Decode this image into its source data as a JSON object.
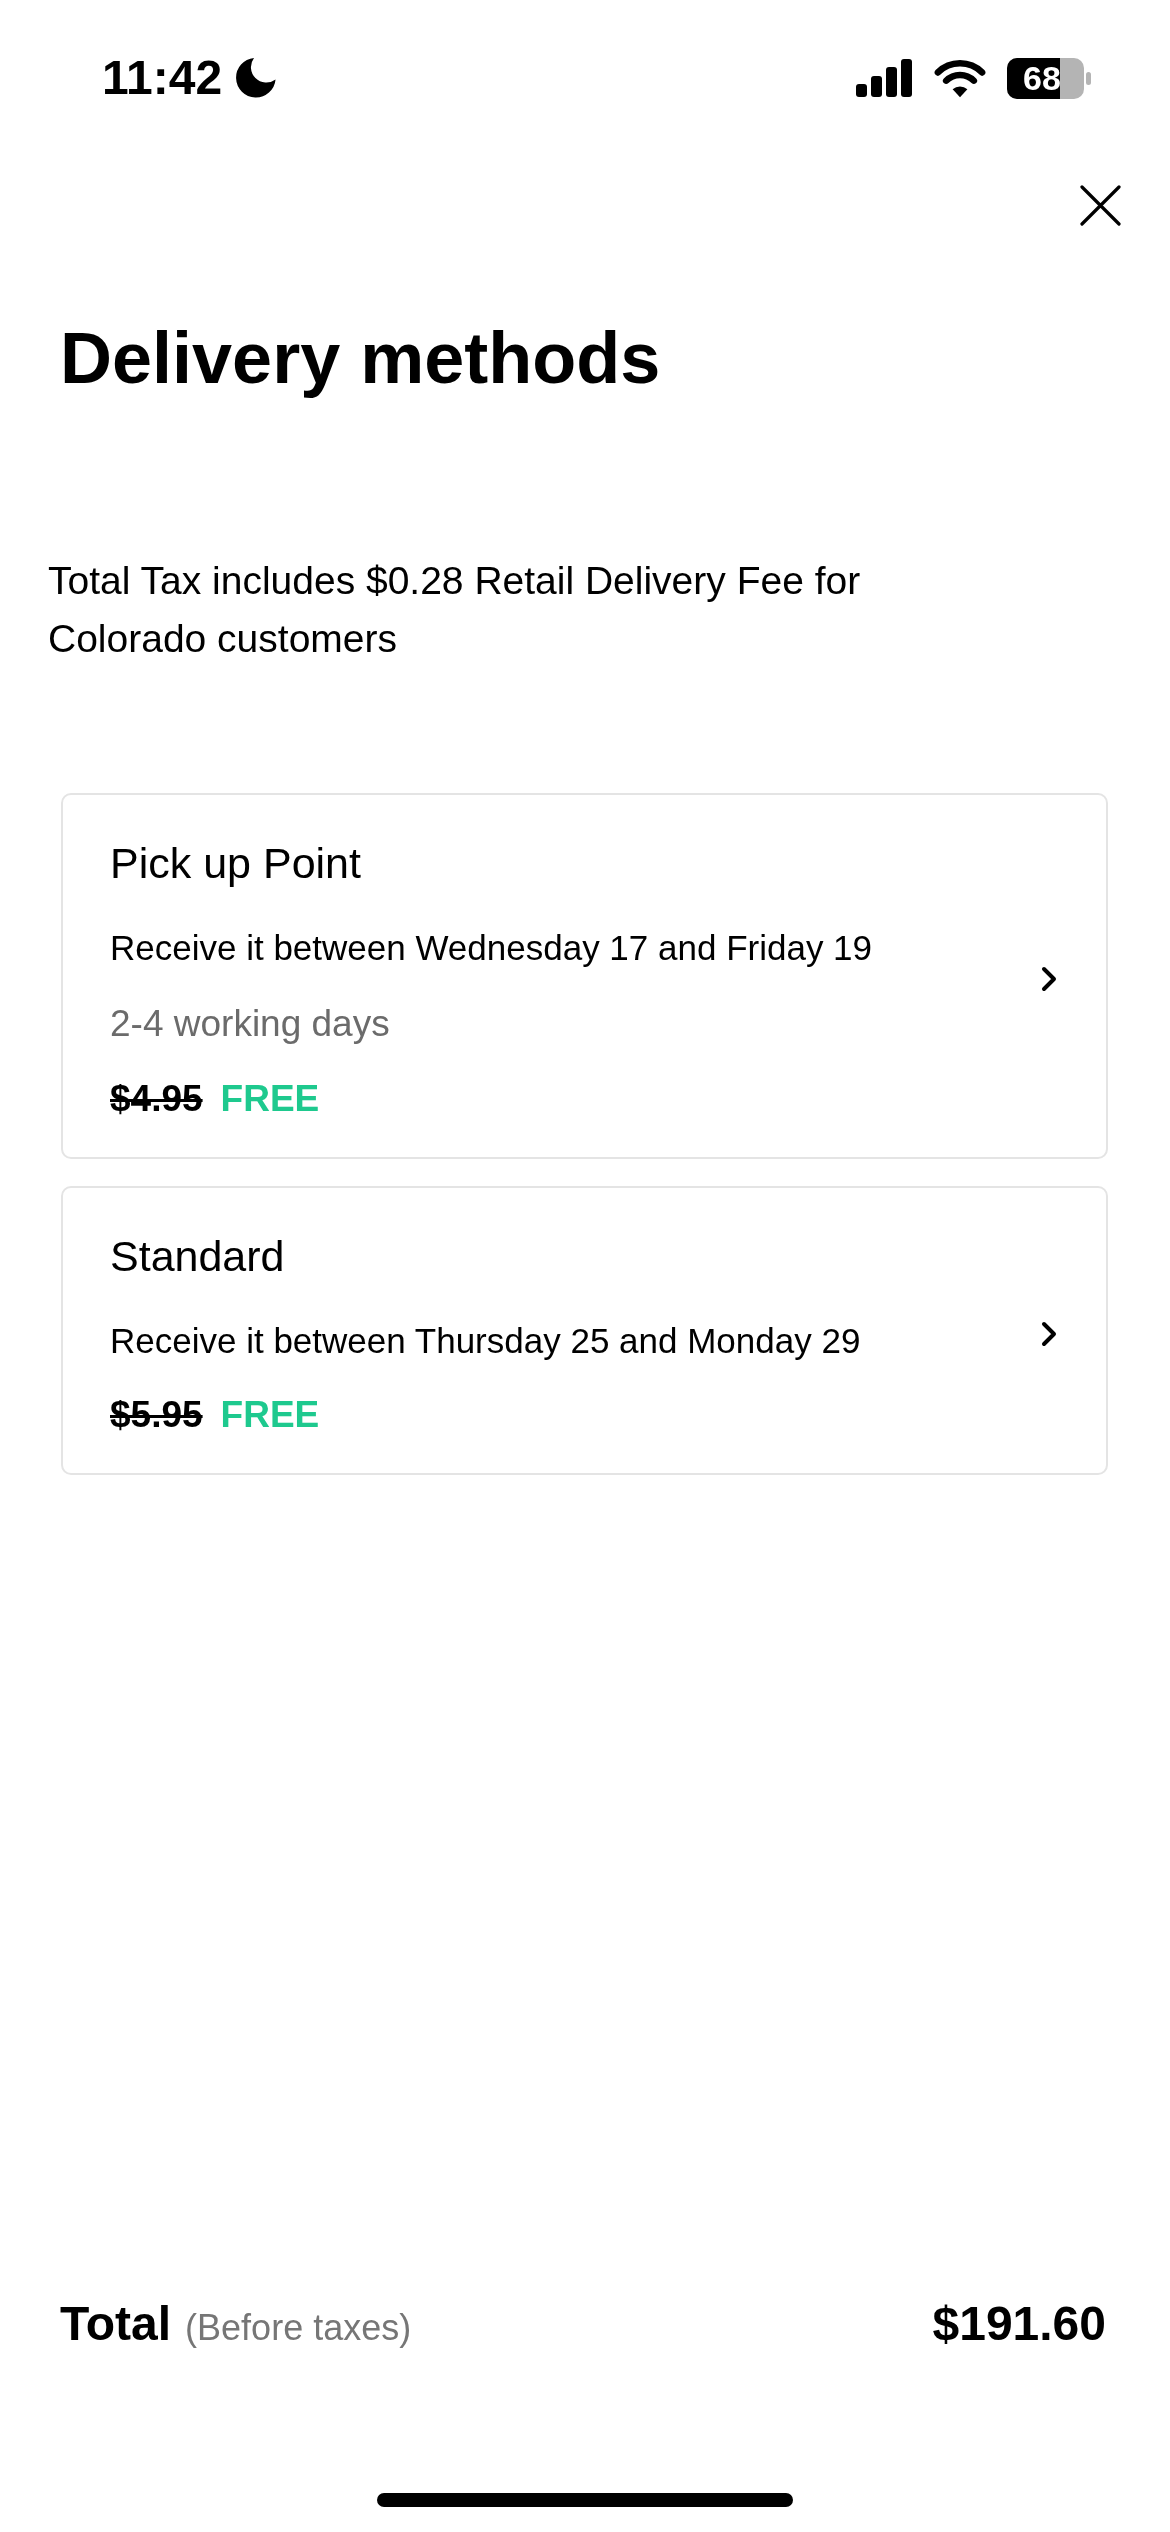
{
  "status_bar": {
    "time": "11:42",
    "battery": "68"
  },
  "title": "Delivery methods",
  "notice": "Total Tax includes $0.28 Retail Delivery Fee for Colorado customers",
  "methods": [
    {
      "name": "Pick up Point",
      "window": "Receive it between Wednesday 17 and Friday 19",
      "duration": "2-4 working days",
      "old_price": "$4.95",
      "price": "FREE"
    },
    {
      "name": "Standard",
      "window": "Receive it between Thursday 25 and Monday 29",
      "old_price": "$5.95",
      "price": "FREE"
    }
  ],
  "total": {
    "label": "Total",
    "note": "(Before taxes)",
    "amount": "$191.60"
  }
}
